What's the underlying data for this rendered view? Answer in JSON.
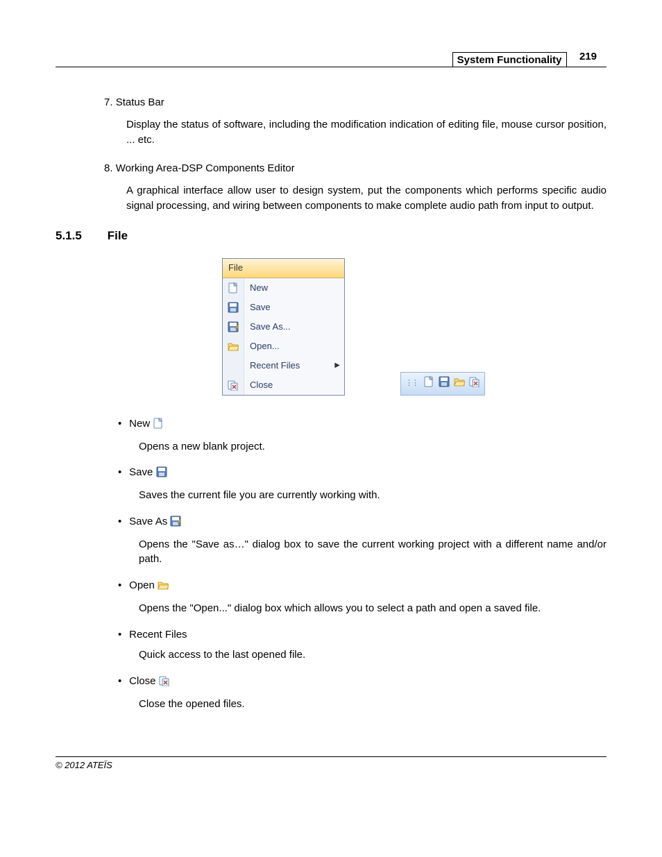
{
  "header": {
    "title": "System Functionality",
    "page": "219"
  },
  "items": [
    {
      "num": "7.",
      "title": "Status Bar",
      "body": "Display the status of software, including the modification indication of editing file, mouse cursor position, ... etc."
    },
    {
      "num": "8.",
      "title": "Working Area-DSP Components Editor",
      "body": "A graphical interface allow user to design system, put the components which performs specific audio signal processing, and wiring between components to make complete audio path from input to output."
    }
  ],
  "section": {
    "num": "5.1.5",
    "title": "File"
  },
  "menu": {
    "head": "File",
    "rows": [
      {
        "icon": "new",
        "label": "New"
      },
      {
        "icon": "save",
        "label": "Save"
      },
      {
        "icon": "saveas",
        "label": "Save As..."
      },
      {
        "icon": "open",
        "label": "Open..."
      },
      {
        "icon": "",
        "label": "Recent Files",
        "arrow": true
      },
      {
        "icon": "close",
        "label": "Close"
      }
    ]
  },
  "toolbar": {
    "icons": [
      "new",
      "save",
      "open",
      "close"
    ]
  },
  "bullets": [
    {
      "label": "New",
      "icon": "new",
      "desc": "Opens a new blank project."
    },
    {
      "label": "Save",
      "icon": "save",
      "desc": "Saves the current file you are currently working with."
    },
    {
      "label": "Save As",
      "icon": "saveas",
      "desc": "Opens the \"Save as…\" dialog box to save the current working project with a different name and/or path."
    },
    {
      "label": "Open",
      "icon": "open",
      "desc": "Opens the \"Open...\" dialog box which allows you to select a path and open a saved file."
    },
    {
      "label": "Recent Files",
      "icon": "",
      "desc": "Quick access to the last opened file."
    },
    {
      "label": "Close",
      "icon": "close",
      "desc": "Close the opened files."
    }
  ],
  "footer": "© 2012 ATEÏS"
}
